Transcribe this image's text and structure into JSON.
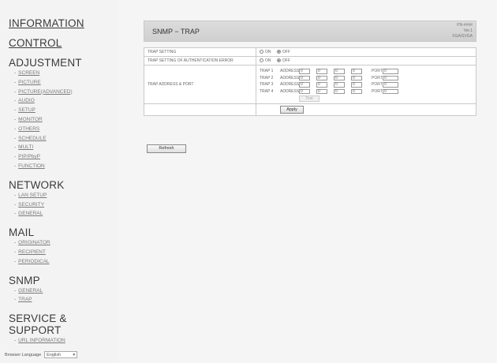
{
  "sidebar": {
    "information": "INFORMATION",
    "control": "CONTROL",
    "adjustment": {
      "title": "ADJUSTMENT",
      "items": [
        "SCREEN",
        "PICTURE",
        "PICTURE(ADVANCED)",
        "AUDIO",
        "SETUP",
        "MONITOR",
        "OTHERS",
        "SCHEDULE",
        "MULTI",
        "PIP/PbyP",
        "FUNCTION"
      ]
    },
    "network": {
      "title": "NETWORK",
      "items": [
        "LAN SETUP",
        "SECURITY",
        "GENERAL"
      ]
    },
    "mail": {
      "title": "MAIL",
      "items": [
        "ORIGINATOR",
        "RECIPIENT",
        "PERIODICAL"
      ]
    },
    "snmp": {
      "title": "SNMP",
      "items": [
        "GENERAL",
        "TRAP"
      ]
    },
    "service": {
      "title": "SERVICE & SUPPORT",
      "items": [
        "URL INFORMATION"
      ]
    },
    "language": {
      "label": "Browser Language",
      "value": "English"
    }
  },
  "header": {
    "title": "SNMP − TRAP",
    "right_lines": [
      "PN-####",
      "Ver.1",
      "XGA/SVGA"
    ]
  },
  "table": {
    "trap_setting": {
      "label": "TRAP SETTING",
      "on": "ON",
      "off": "OFF",
      "selected": "OFF"
    },
    "auth_error": {
      "label": "TRAP SETTING OF AUTHENTICATION ERROR",
      "on": "ON",
      "off": "OFF",
      "selected": "OFF"
    },
    "address_port": {
      "label": "TRAP ADDRESS & PORT",
      "address_label": "ADDRESS",
      "port_label": "PORT",
      "rows": [
        {
          "name": "TRAP 1",
          "octets": [
            "0",
            "0",
            "0",
            "0"
          ],
          "port": "0"
        },
        {
          "name": "TRAP 2",
          "octets": [
            "0",
            "0",
            "0",
            "0"
          ],
          "port": "0"
        },
        {
          "name": "TRAP 3",
          "octets": [
            "0",
            "0",
            "0",
            "0"
          ],
          "port": "0"
        },
        {
          "name": "TRAP 4",
          "octets": [
            "0",
            "0",
            "0",
            "0"
          ],
          "port": "0"
        }
      ],
      "test_label": "Test"
    },
    "apply_label": "Apply"
  },
  "refresh_label": "Refresh"
}
